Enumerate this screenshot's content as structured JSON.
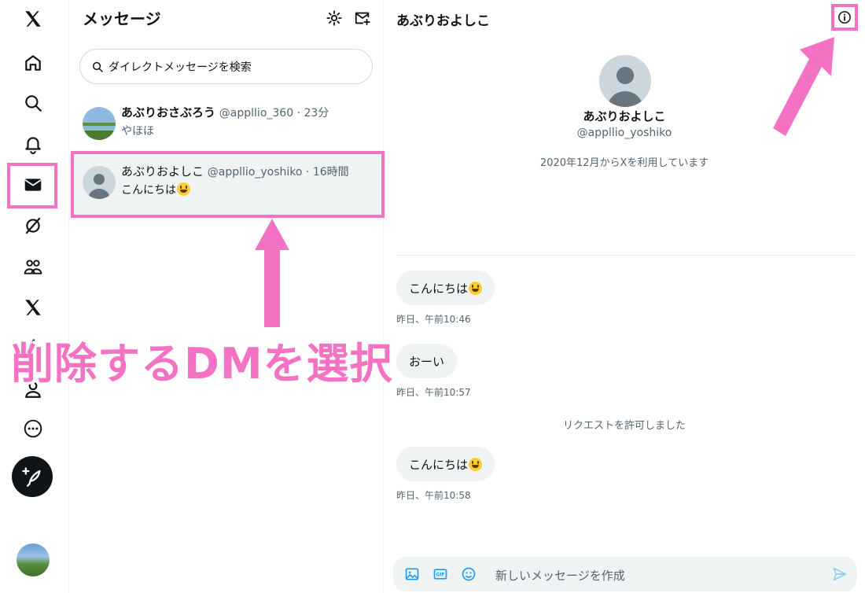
{
  "nav": {
    "items": [
      {
        "icon": "x-logo-icon"
      },
      {
        "icon": "home-icon"
      },
      {
        "icon": "search-icon"
      },
      {
        "icon": "bell-icon"
      },
      {
        "icon": "mail-icon",
        "active": true
      },
      {
        "icon": "grok-icon"
      },
      {
        "icon": "communities-icon"
      },
      {
        "icon": "premium-x-icon"
      },
      {
        "icon": "lightning-icon"
      },
      {
        "icon": "profile-icon"
      },
      {
        "icon": "more-icon"
      }
    ],
    "compose_icon": "feather-plus-icon",
    "highlight_color": "#f472c3"
  },
  "list": {
    "title": "メッセージ",
    "search_placeholder": "ダイレクトメッセージを検索",
    "conversations": [
      {
        "name": "あぶりおさぶろう",
        "handle": "@appllio_360",
        "time": "23分",
        "preview": "やほほ"
      },
      {
        "name": "あぶりおよしこ",
        "handle": "@appllio_yoshiko",
        "time": "16時間",
        "preview": "こんにちは",
        "selected": true
      }
    ]
  },
  "annotation": {
    "text": "削除するDMを選択",
    "color": "#f472c3"
  },
  "chat": {
    "title": "あぶりおよしこ",
    "profile_name": "あぶりおよしこ",
    "profile_handle": "@appllio_yoshiko",
    "joined": "2020年12月からXを利用しています",
    "messages": [
      {
        "text": "こんにちは",
        "emoji": true,
        "time": "昨日、午前10:46"
      },
      {
        "text": "おーい",
        "emoji": false,
        "time": "昨日、午前10:57"
      },
      {
        "text": "こんにちは",
        "emoji": true,
        "time": "昨日、午前10:58"
      }
    ],
    "system_message": "リクエストを許可しました",
    "composer_placeholder": "新しいメッセージを作成",
    "accent": "#1d9bf0"
  }
}
